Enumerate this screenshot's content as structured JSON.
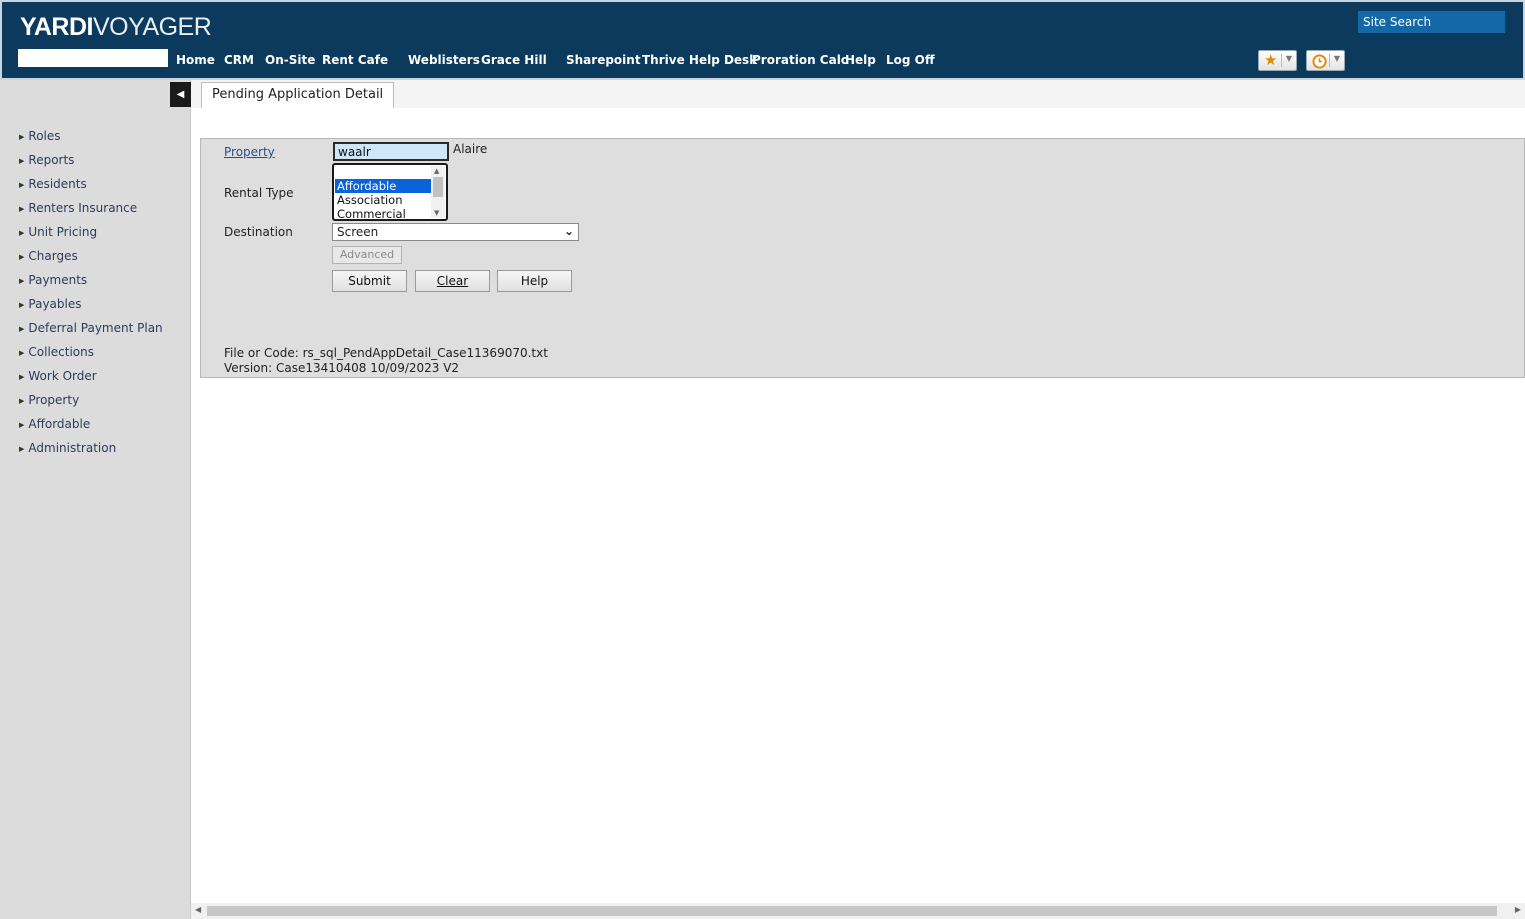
{
  "header": {
    "logo_part1": "YARDI",
    "logo_part2": "VOYAGER",
    "site_search": "Site Search",
    "nav": [
      "Home",
      "CRM",
      "On-Site",
      "Rent Cafe",
      "Weblisters",
      "Grace Hill",
      "Sharepoint",
      "Thrive Help Desk",
      "Proration Calc",
      "Help",
      "Log Off"
    ],
    "favorites_icon": "star-icon",
    "history_icon": "clock-icon"
  },
  "sidebar": {
    "items": [
      "Roles",
      "Reports",
      "Residents",
      "Renters Insurance",
      "Unit Pricing",
      "Charges",
      "Payments",
      "Payables",
      "Deferral Payment Plan",
      "Collections",
      "Work Order",
      "Property",
      "Affordable",
      "Administration"
    ]
  },
  "tab": {
    "title": "Pending Application Detail"
  },
  "form": {
    "property_label": "Property",
    "property_value": "waalr",
    "property_name": "Alaire",
    "rental_type_label": "Rental Type",
    "rental_type_options": [
      "Affordable",
      "Association",
      "Commercial"
    ],
    "rental_type_selected": "Affordable",
    "destination_label": "Destination",
    "destination_value": "Screen",
    "advanced_label": "Advanced",
    "submit_label": "Submit",
    "clear_label": "Clear",
    "help_label": "Help",
    "file_info": "File or Code: rs_sql_PendAppDetail_Case11369070.txt",
    "version_info": "Version: Case13410408 10/09/2023 V2"
  },
  "colors": {
    "header_bg": "#0b3a5c",
    "site_search_bg": "#1468a6",
    "selected_option": "#0a63d8",
    "panel_bg": "#dedede",
    "sidebar_bg": "#dcdcdc"
  }
}
